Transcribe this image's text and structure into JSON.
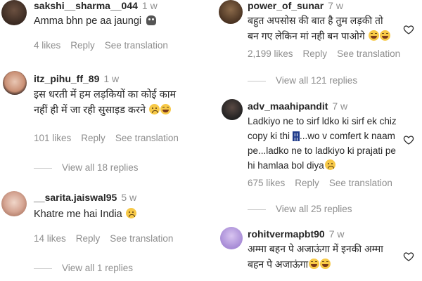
{
  "labels": {
    "reply": "Reply",
    "see_translation": "See translation"
  },
  "left_comments": [
    {
      "username": "sakshi__sharma__044",
      "time": "1 w",
      "text": "Amma bhn pe aa jaungi",
      "likes": "4 likes",
      "replies": ""
    },
    {
      "username": "itz_pihu_ff_89",
      "time": "1 w",
      "text_line1": "इस धरती में हम लड़कियों का कोई काम",
      "text_line2": "नहीं ही में जा रही सुसाइड करने",
      "likes": "101 likes",
      "replies": "View all 18 replies"
    },
    {
      "username": "__sarita.jaiswal95",
      "time": "5 w",
      "text": "Khatre me hai India",
      "likes": "14 likes",
      "replies": "View all 1 replies"
    }
  ],
  "right_comments": [
    {
      "username": "power_of_sunar",
      "time": "7 w",
      "text_line1": "बहुत अपसोस की बात है तुम लड़की तो",
      "text_line2": "बन गए लेकिन मां नही बन पाओगे",
      "likes": "2,199 likes",
      "replies": "View all 121 replies"
    },
    {
      "username": "adv_maahipandit",
      "time": "7 w",
      "text_line1": "Ladkiyo ne to sirf ldko ki sirf ek chiz",
      "text_line2a": "copy ki thi",
      "text_line2b": "...wo v comfert k naam",
      "text_line3": "pe...ladko ne to ladkiyo ki prajati pe",
      "text_line4": "hi hamlaa bol diya",
      "likes": "675 likes",
      "replies": "View all 25 replies"
    },
    {
      "username": "rohitvermapbt90",
      "time": "7 w",
      "text_line1": "अम्मा बहन पे अजाऊंगा में इनकी अम्मा",
      "text_line2": "बहन पे अजाऊंगा"
    }
  ],
  "colors": {
    "text": "#262626",
    "muted": "#8e8e8e",
    "background": "#ffffff"
  }
}
